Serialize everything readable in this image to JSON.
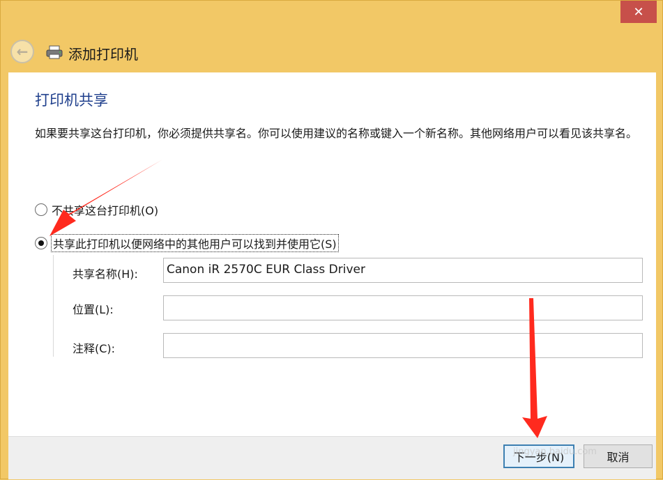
{
  "window": {
    "close_label": "✕",
    "title": "添加打印机"
  },
  "page": {
    "heading": "打印机共享",
    "description": "如果要共享这台打印机，你必须提供共享名。你可以使用建议的名称或键入一个新名称。其他网络用户可以看见该共享名。"
  },
  "options": [
    {
      "label": "不共享这台打印机(O)",
      "selected": false
    },
    {
      "label": "共享此打印机以便网络中的其他用户可以找到并使用它(S)",
      "selected": true
    }
  ],
  "fields": {
    "share_name": {
      "label": "共享名称(H):",
      "value": "Canon iR 2570C EUR Class Driver"
    },
    "location": {
      "label": "位置(L):",
      "value": ""
    },
    "comment": {
      "label": "注释(C):",
      "value": ""
    }
  },
  "footer": {
    "next_label": "下一步(N)",
    "cancel_label": "取消"
  },
  "watermark": {
    "brand": "Baidu经验",
    "url": "jingyan.baidu.com"
  },
  "colors": {
    "window_frame": "#f2c866",
    "heading": "#1f3f8c",
    "close_button": "#c7504a",
    "annotation_arrow": "#ff2a1e"
  }
}
